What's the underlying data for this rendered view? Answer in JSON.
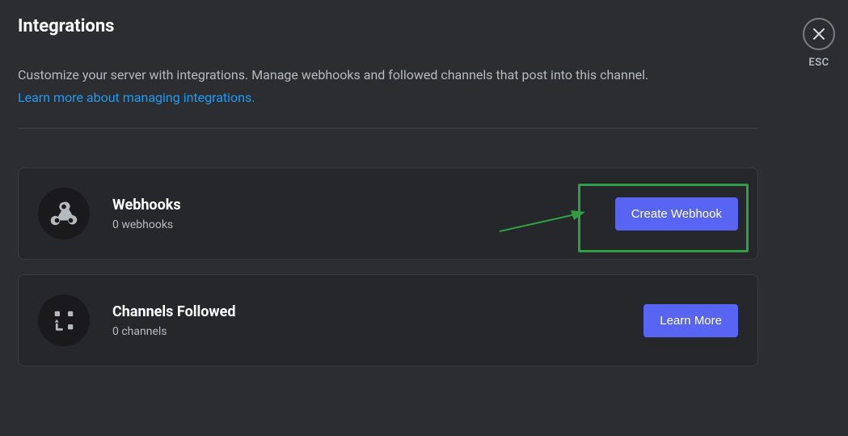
{
  "page": {
    "title": "Integrations",
    "subtitle": "Customize your server with integrations. Manage webhooks and followed channels that post into this channel.",
    "learn_link": "Learn more about managing integrations."
  },
  "close": {
    "esc_label": "ESC"
  },
  "cards": {
    "webhooks": {
      "title": "Webhooks",
      "subtitle": "0 webhooks",
      "button": "Create Webhook"
    },
    "channels_followed": {
      "title": "Channels Followed",
      "subtitle": "0 channels",
      "button": "Learn More"
    }
  },
  "annotation": {
    "highlight_color": "#2ea043",
    "arrow_color": "#2ea043"
  }
}
